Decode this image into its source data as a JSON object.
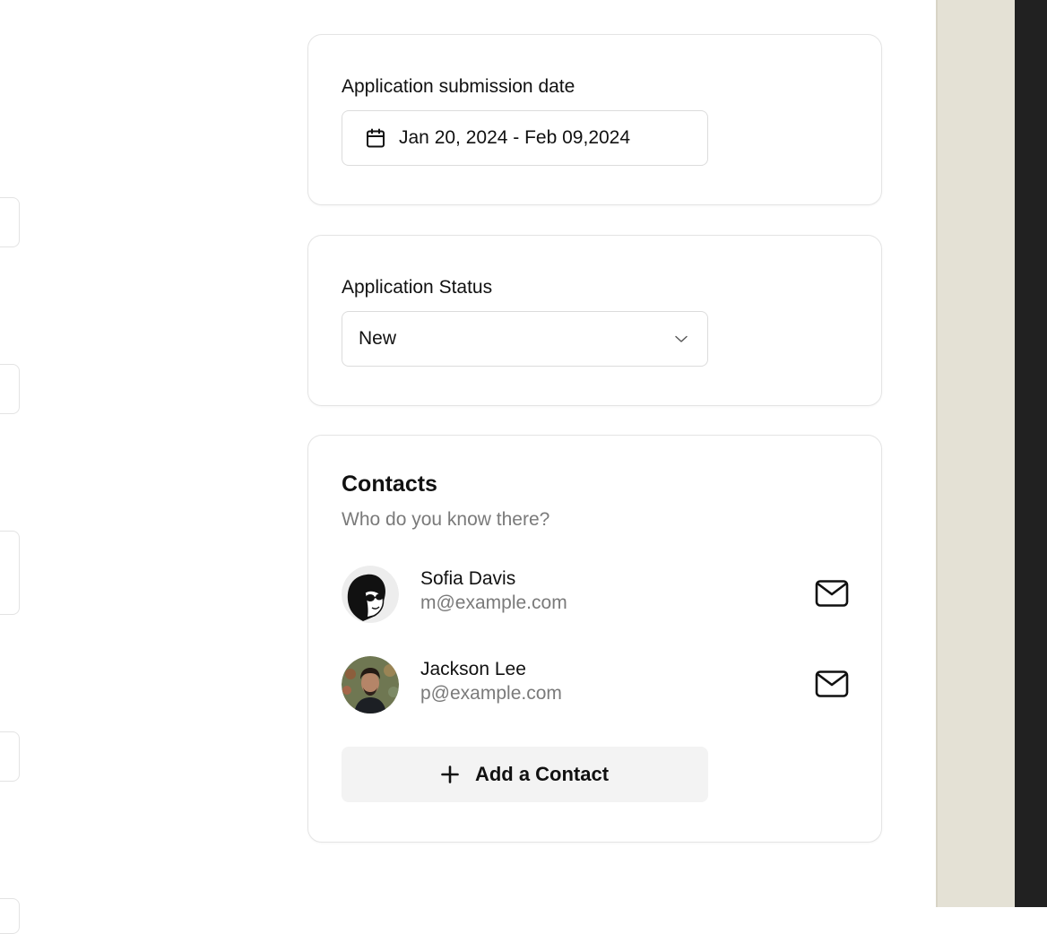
{
  "date_card": {
    "label": "Application submission date",
    "range_value": "Jan 20, 2024 - Feb 09,2024",
    "icon": "calendar-icon"
  },
  "status_card": {
    "label": "Application Status",
    "selected": "New",
    "icon": "chevron-down-icon"
  },
  "contacts_card": {
    "title": "Contacts",
    "subtitle": "Who do you know there?",
    "contacts": [
      {
        "name": "Sofia Davis",
        "email": "m@example.com",
        "avatar": "illustrated-avatar",
        "action_icon": "mail-icon"
      },
      {
        "name": "Jackson Lee",
        "email": "p@example.com",
        "avatar": "photo-avatar",
        "action_icon": "mail-icon"
      }
    ],
    "add_button": {
      "label": "Add a Contact",
      "icon": "plus-icon"
    }
  },
  "colors": {
    "side_panel": "#e4e1d5",
    "dark_edge": "#212121",
    "muted_text": "#7a7a7a",
    "button_bg": "#f3f3f3"
  }
}
